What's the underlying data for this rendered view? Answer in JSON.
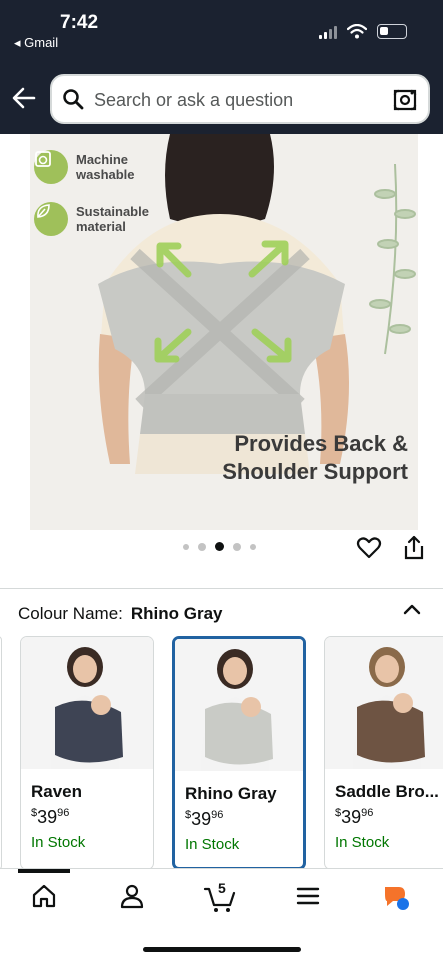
{
  "status_bar": {
    "time": "7:42",
    "back_app": "◂ Gmail"
  },
  "search": {
    "placeholder": "Search or ask a question"
  },
  "hero": {
    "badges": [
      {
        "icon": "washing-machine-icon",
        "label": "Machine washable"
      },
      {
        "icon": "leaf-icon",
        "label": "Sustainable material"
      }
    ],
    "caption_line1": "Provides Back &",
    "caption_line2": "Shoulder Support"
  },
  "carousel": {
    "count": 5,
    "active_index": 2
  },
  "colour": {
    "label": "Colour Name:",
    "value": "Rhino Gray",
    "options": [
      {
        "name": "Raven",
        "price_dollars": "39",
        "price_cents": "96",
        "stock": "In Stock",
        "color": "#3b4150"
      },
      {
        "name": "Rhino Gray",
        "price_dollars": "39",
        "price_cents": "96",
        "stock": "In Stock",
        "color": "#c9cbc6"
      },
      {
        "name": "Saddle Bro...",
        "price_dollars": "39",
        "price_cents": "96",
        "stock": "In Stock",
        "color": "#6e5443"
      }
    ]
  },
  "bottom_nav": {
    "cart_count": "5"
  },
  "colors": {
    "header_bg": "#1b2230",
    "in_stock": "#007600",
    "selected_border": "#2162a1",
    "badge_green": "#9fc05a"
  }
}
